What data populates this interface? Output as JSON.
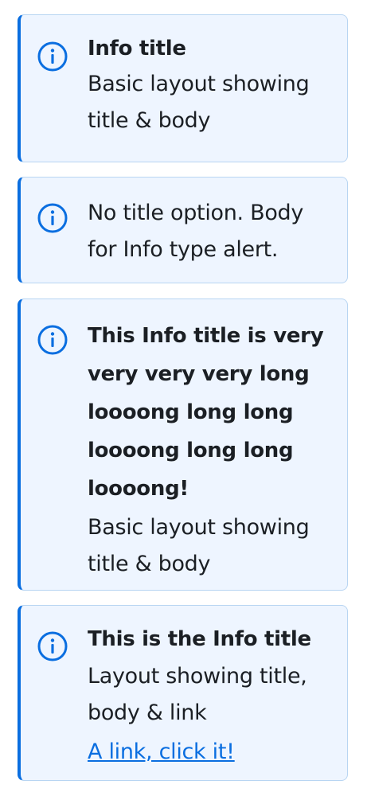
{
  "colors": {
    "accent": "#0a6ee0",
    "alert_background": "#eef5ff",
    "alert_border": "#b8d5f2",
    "text": "#1b1f24"
  },
  "alerts": [
    {
      "type": "info",
      "icon": "info-icon",
      "title": "Info title",
      "body": "Basic layout showing title & body"
    },
    {
      "type": "info",
      "icon": "info-icon",
      "body": "No title option. Body for Info type alert."
    },
    {
      "type": "info",
      "icon": "info-icon",
      "title": "This Info title is very very very very  long loooong long long loooong long long loooong!",
      "body": "Basic layout showing title & body"
    },
    {
      "type": "info",
      "icon": "info-icon",
      "title": "This is the Info title",
      "body": "Layout showing title, body & link",
      "link": "A link, click it!"
    }
  ]
}
